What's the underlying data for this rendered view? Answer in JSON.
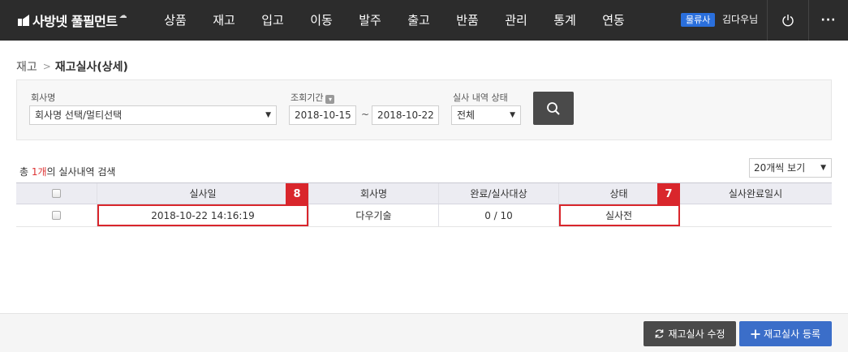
{
  "brand": {
    "name": "사방넷 풀필먼트"
  },
  "nav": [
    {
      "label": "상품"
    },
    {
      "label": "재고"
    },
    {
      "label": "입고"
    },
    {
      "label": "이동"
    },
    {
      "label": "발주"
    },
    {
      "label": "출고"
    },
    {
      "label": "반품"
    },
    {
      "label": "관리"
    },
    {
      "label": "통계"
    },
    {
      "label": "연동"
    }
  ],
  "user": {
    "badge": "물류사",
    "name": "김다우님"
  },
  "breadcrumb": {
    "parent": "재고",
    "current": "재고실사(상세)"
  },
  "search": {
    "company_label": "회사명",
    "company_value": "회사명 선택/멀티선택",
    "period_label": "조회기간",
    "date_from": "2018-10-15",
    "date_to": "2018-10-22",
    "tilde": "~",
    "status_label": "실사 내역 상태",
    "status_value": "전체"
  },
  "results": {
    "prefix": "총 ",
    "count": "1개",
    "suffix": "의 실사내역 검색",
    "page_size": "20개씩 보기"
  },
  "table": {
    "headers": [
      "실사일",
      "회사명",
      "완료/실사대상",
      "상태",
      "실사완료일시"
    ],
    "rows": [
      {
        "date": "2018-10-22 14:16:19",
        "company": "다우기술",
        "progress": "0 / 10",
        "status": "실사전",
        "completed_at": ""
      }
    ]
  },
  "annotations": {
    "date_badge": "8",
    "status_badge": "7"
  },
  "footer": {
    "edit_label": "재고실사 수정",
    "register_label": "재고실사 등록"
  },
  "colors": {
    "accent": "#3b6ec9",
    "highlight": "#d9262c",
    "topbar": "#2c2c2c"
  }
}
